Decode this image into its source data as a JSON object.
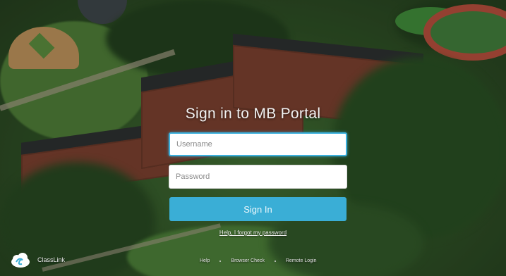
{
  "page": {
    "title": "Sign in to MB Portal"
  },
  "form": {
    "username_placeholder": "Username",
    "username_value": "",
    "password_placeholder": "Password",
    "password_value": "",
    "signin_label": "Sign In",
    "forgot_label": "Help, I forgot my password"
  },
  "brand": {
    "name": "ClassLink",
    "icon": "classlink-cloud-icon"
  },
  "footer": {
    "links": [
      "Help",
      "Browser Check",
      "Remote Login"
    ]
  },
  "colors": {
    "accent": "#3aaed6",
    "focus_border": "#3bb0dd"
  }
}
